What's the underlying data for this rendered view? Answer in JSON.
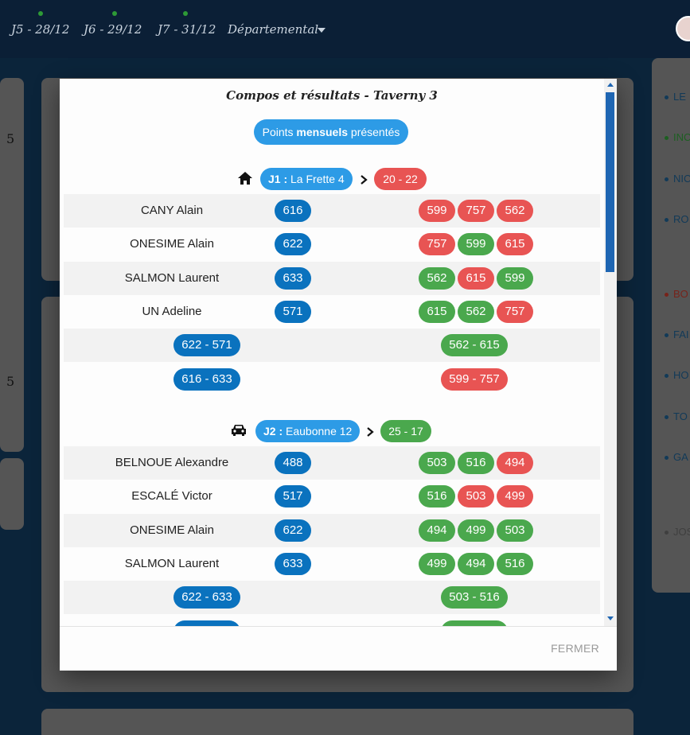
{
  "nav": {
    "tabs": [
      {
        "label": "J5 - 28/12"
      },
      {
        "label": "J6 - 29/12"
      },
      {
        "label": "J7 - 31/12"
      }
    ],
    "dropdown_label": "Départemental"
  },
  "background": {
    "numbers": [
      "5",
      "5"
    ],
    "right_list": [
      {
        "text": "LE",
        "color": "#1d5e8f"
      },
      {
        "text": "INC",
        "color": "#2e9a36"
      },
      {
        "text": "NIC",
        "color": "#1d5e8f"
      },
      {
        "text": "RO",
        "color": "#1d5e8f"
      },
      {
        "text": "BO",
        "color": "#c0392b"
      },
      {
        "text": "FAI",
        "color": "#1d5e8f"
      },
      {
        "text": "HO",
        "color": "#1d5e8f"
      },
      {
        "text": "TO",
        "color": "#1d5e8f"
      },
      {
        "text": "GA",
        "color": "#1d5e8f"
      },
      {
        "text": "JOS",
        "color": "#666666"
      }
    ]
  },
  "modal": {
    "title": "Compos et résultats - Taverny 3",
    "points_prefix": "Points ",
    "points_bold": "mensuels",
    "points_suffix": " présentés",
    "close_label": "FERMER",
    "matches": [
      {
        "journee_id": "J1 :",
        "opponent": "La Frette 4",
        "venue_icon": "home-icon",
        "score": "20 - 22",
        "score_color": "red",
        "players": [
          {
            "name": "CANY Alain",
            "points": "616",
            "results": [
              {
                "v": "599",
                "c": "red"
              },
              {
                "v": "757",
                "c": "red"
              },
              {
                "v": "562",
                "c": "red"
              }
            ]
          },
          {
            "name": "ONESIME Alain",
            "points": "622",
            "results": [
              {
                "v": "757",
                "c": "red"
              },
              {
                "v": "599",
                "c": "green"
              },
              {
                "v": "615",
                "c": "red"
              }
            ]
          },
          {
            "name": "SALMON Laurent",
            "points": "633",
            "results": [
              {
                "v": "562",
                "c": "green"
              },
              {
                "v": "615",
                "c": "red"
              },
              {
                "v": "599",
                "c": "green"
              }
            ]
          },
          {
            "name": "UN Adeline",
            "points": "571",
            "results": [
              {
                "v": "615",
                "c": "green"
              },
              {
                "v": "562",
                "c": "green"
              },
              {
                "v": "757",
                "c": "red"
              }
            ]
          }
        ],
        "doubles": [
          {
            "left": "622 - 571",
            "right": "562 - 615",
            "right_color": "green"
          },
          {
            "left": "616 - 633",
            "right": "599 - 757",
            "right_color": "red"
          }
        ]
      },
      {
        "journee_id": "J2 :",
        "opponent": "Eaubonne 12",
        "venue_icon": "car-icon",
        "score": "25 - 17",
        "score_color": "green",
        "players": [
          {
            "name": "BELNOUE Alexandre",
            "points": "488",
            "results": [
              {
                "v": "503",
                "c": "green"
              },
              {
                "v": "516",
                "c": "green"
              },
              {
                "v": "494",
                "c": "red"
              }
            ]
          },
          {
            "name": "ESCALÉ Victor",
            "points": "517",
            "results": [
              {
                "v": "516",
                "c": "green"
              },
              {
                "v": "503",
                "c": "red"
              },
              {
                "v": "499",
                "c": "red"
              }
            ]
          },
          {
            "name": "ONESIME Alain",
            "points": "622",
            "results": [
              {
                "v": "494",
                "c": "green"
              },
              {
                "v": "499",
                "c": "green"
              },
              {
                "v": "503",
                "c": "green"
              }
            ]
          },
          {
            "name": "SALMON Laurent",
            "points": "633",
            "results": [
              {
                "v": "499",
                "c": "green"
              },
              {
                "v": "494",
                "c": "green"
              },
              {
                "v": "516",
                "c": "green"
              }
            ]
          }
        ],
        "doubles": [
          {
            "left": "622 - 633",
            "right": "503 - 516",
            "right_color": "green"
          }
        ]
      }
    ]
  },
  "colors": {
    "accent_blue": "#2d9be6",
    "points_blue": "#0a72be",
    "win_green": "#4aa84d",
    "loss_red": "#e85453"
  }
}
